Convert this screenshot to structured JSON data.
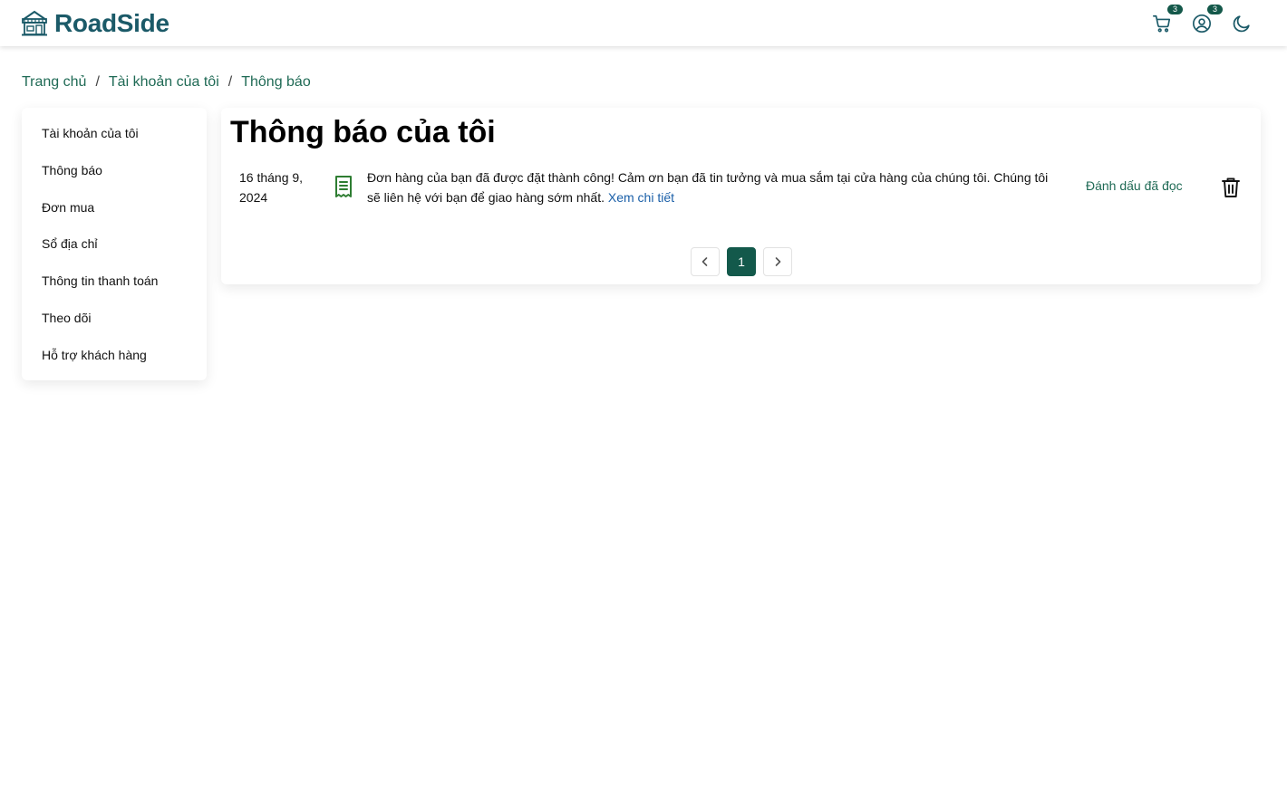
{
  "brand": {
    "name": "RoadSide",
    "color": "#1b5a68"
  },
  "header": {
    "cart_icon": "cart-icon",
    "cart_count": "3",
    "user_icon": "user-circle-icon",
    "user_count": "3",
    "theme_icon": "moon-icon"
  },
  "breadcrumb": [
    "Trang chủ",
    "Tài khoản của tôi",
    "Thông báo"
  ],
  "sidebar": {
    "items": [
      {
        "label": "Tài khoản của tôi"
      },
      {
        "label": "Thông báo"
      },
      {
        "label": "Đơn mua"
      },
      {
        "label": "Sổ địa chỉ"
      },
      {
        "label": "Thông tin thanh toán"
      },
      {
        "label": "Theo dõi"
      },
      {
        "label": "Hỗ trợ khách hàng"
      }
    ]
  },
  "main": {
    "title": "Thông báo của tôi",
    "notifications": [
      {
        "date": "16 tháng 9, 2024",
        "icon": "receipt-icon",
        "message": "Đơn hàng của bạn đã được đặt thành công! Cảm ơn bạn đã tin tưởng và mua sắm tại cửa hàng của chúng tôi. Chúng tôi sẽ liên hệ với bạn để giao hàng sớm nhất.",
        "link_text": "Xem chi tiết",
        "mark_read_label": "Đánh dấu đã đọc",
        "delete_icon": "trash-icon"
      }
    ],
    "pagination": {
      "current_page": "1"
    }
  },
  "colors": {
    "accent": "#13594b",
    "link": "#1a5fa8",
    "breadcrumb": "#1f6a55",
    "icon_green": "#2e7d32"
  }
}
